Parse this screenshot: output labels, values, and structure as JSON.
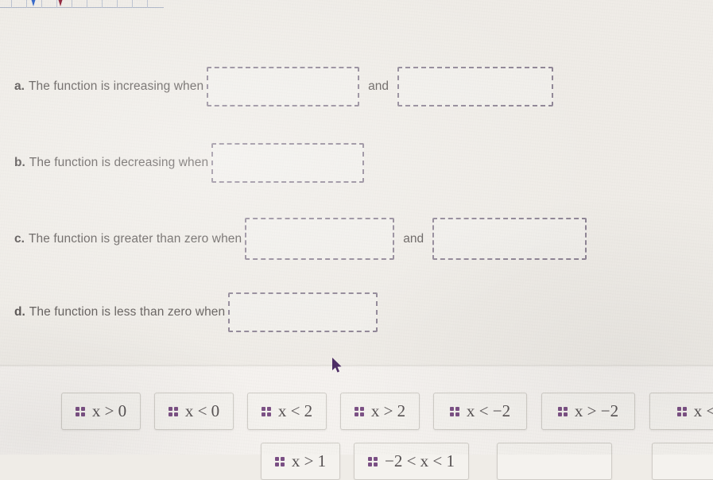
{
  "page": {
    "background_color": "#efece7",
    "cursor_color": "#4b2a63"
  },
  "graph_strip": {
    "description": "cropped bottom edge of a coordinate grid",
    "grid_line_color": "#b9c0cf",
    "arrows": [
      {
        "name": "blue-axis-arrow",
        "color": "#2f63c8",
        "x": 40
      },
      {
        "name": "red-axis-arrow",
        "color": "#8f2038",
        "x": 74
      }
    ],
    "grid_x_positions": [
      14,
      33,
      52,
      71,
      90,
      109,
      128,
      147,
      166,
      185
    ]
  },
  "questions": [
    {
      "id": "a",
      "label": "a.",
      "text": "The function is increasing when",
      "blanks": 2,
      "conjunction": "and",
      "answers": [
        "",
        ""
      ]
    },
    {
      "id": "b",
      "label": "b.",
      "text": "The function is decreasing when",
      "blanks": 1,
      "conjunction": "",
      "answers": [
        ""
      ]
    },
    {
      "id": "c",
      "label": "c.",
      "text": "The function is greater than zero when",
      "blanks": 2,
      "conjunction": "and",
      "answers": [
        "",
        ""
      ]
    },
    {
      "id": "d",
      "label": "d.",
      "text": "The function is less than zero when",
      "blanks": 1,
      "conjunction": "",
      "answers": [
        ""
      ]
    }
  ],
  "tile_bank": {
    "handle_icon": "drag-handle-icon",
    "handle_color": "#7a4f84",
    "row1": [
      {
        "expr": "x > 0",
        "var": "x",
        "op": ">",
        "value": "0"
      },
      {
        "expr": "x < 0",
        "var": "x",
        "op": "<",
        "value": "0"
      },
      {
        "expr": "x < 2",
        "var": "x",
        "op": "<",
        "value": "2"
      },
      {
        "expr": "x > 2",
        "var": "x",
        "op": ">",
        "value": "2"
      },
      {
        "expr": "x < −2",
        "var": "x",
        "op": "<",
        "value": "−2"
      },
      {
        "expr": "x > −2",
        "var": "x",
        "op": ">",
        "value": "−2"
      },
      {
        "expr": "x <",
        "var": "x",
        "op": "<",
        "value": "",
        "clipped": true
      }
    ],
    "row2": [
      {
        "expr": "x > 1",
        "clipped": true
      },
      {
        "expr": "−2 < x < 1",
        "clipped": true
      },
      {
        "expr": "",
        "clipped": true
      },
      {
        "expr": "",
        "clipped": true
      }
    ]
  }
}
